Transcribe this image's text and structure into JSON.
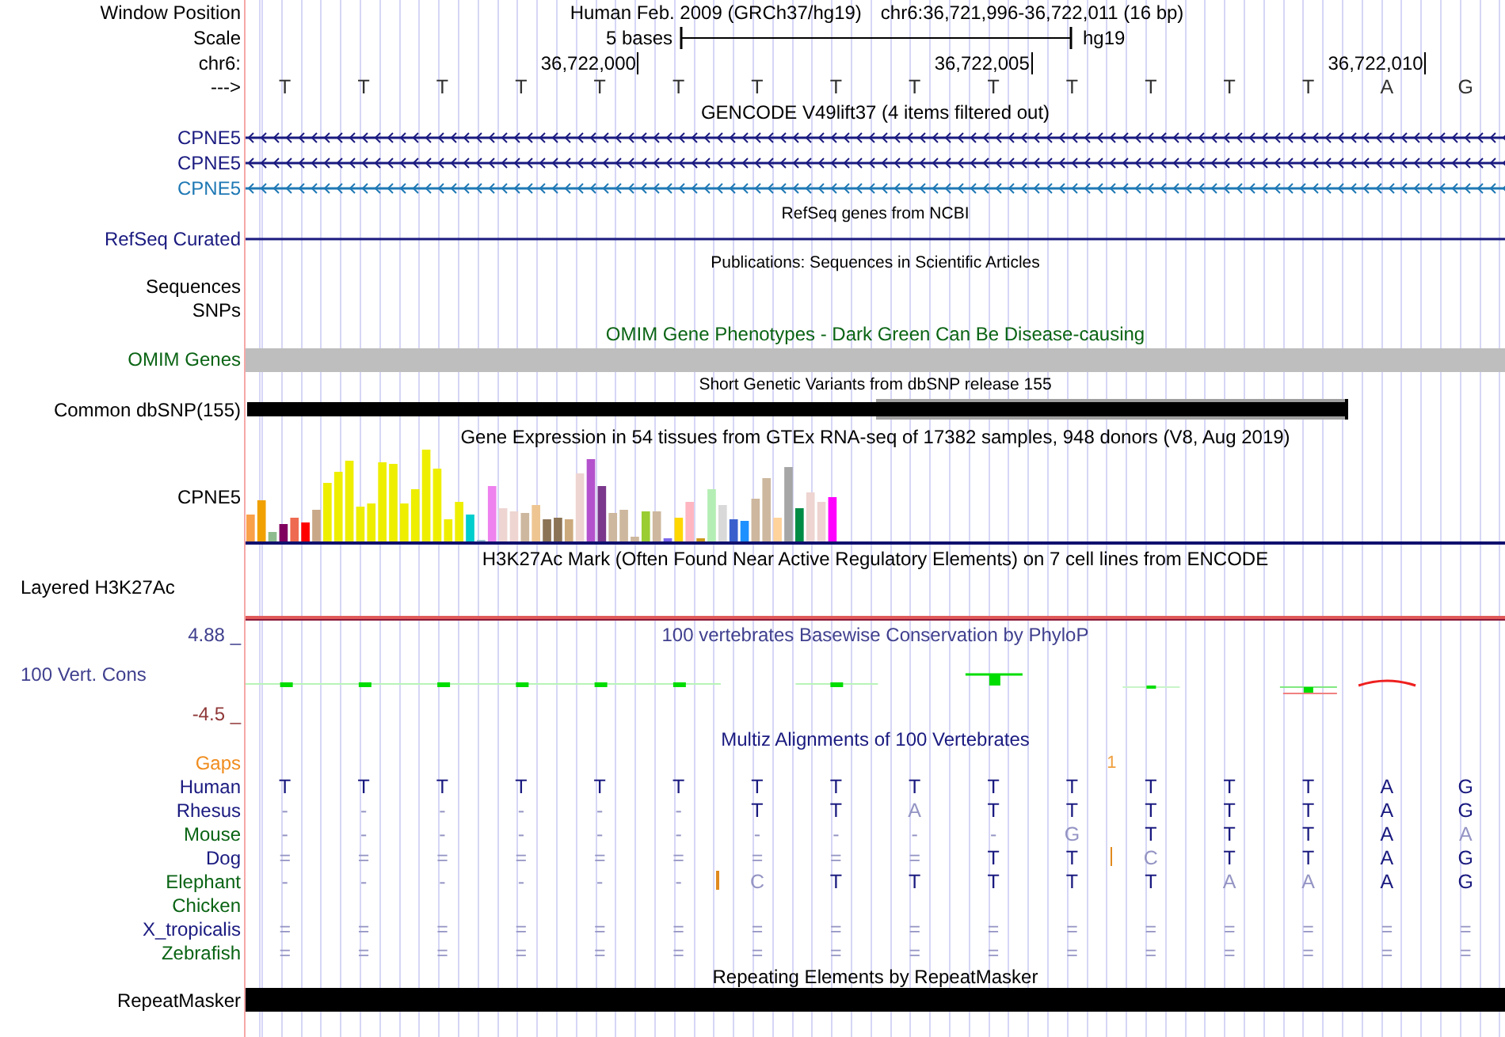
{
  "position": {
    "label": "Window Position",
    "assembly": "Human Feb. 2009 (GRCh37/hg19)",
    "range": "chr6:36,721,996-36,722,011 (16 bp)"
  },
  "scale": {
    "label": "Scale",
    "span": "5 bases",
    "db": "hg19"
  },
  "ruler": {
    "label": "chr6:",
    "ticks": [
      "36,722,000",
      "36,722,005",
      "36,722,010"
    ]
  },
  "sequence": {
    "label": "--->",
    "bases": [
      "T",
      "T",
      "T",
      "T",
      "T",
      "T",
      "T",
      "T",
      "T",
      "T",
      "T",
      "T",
      "T",
      "T",
      "A",
      "G"
    ]
  },
  "tracks": [
    {
      "kind": "gencode",
      "title": "GENCODE V49lift37 (4 items filtered out)",
      "items": [
        {
          "label": "CPNE5",
          "color": "#1a1a80",
          "arrows": true
        },
        {
          "label": "CPNE5",
          "color": "#1a1a80",
          "arrows": true
        },
        {
          "label": "CPNE5",
          "color": "#1e78b4",
          "arrows": true
        }
      ]
    },
    {
      "kind": "refseq",
      "title": "RefSeq genes from NCBI",
      "items": [
        {
          "label": "RefSeq Curated",
          "color": "#1a1a80",
          "arrows": false
        }
      ]
    },
    {
      "kind": "pubs",
      "title": "Publications: Sequences in Scientific Articles",
      "labels": [
        "Sequences",
        "SNPs"
      ]
    },
    {
      "kind": "omim",
      "title": "OMIM Gene Phenotypes - Dark Green Can Be Disease-causing",
      "label": "OMIM Genes"
    },
    {
      "kind": "dbsnp",
      "title": "Short Genetic Variants from dbSNP release 155",
      "label": "Common dbSNP(155)"
    },
    {
      "kind": "gtex",
      "title": "Gene Expression in 54 tissues from GTEx RNA-seq of 17382 samples, 948 donors (V8, Aug 2019)",
      "label": "CPNE5"
    },
    {
      "kind": "h3k27ac",
      "title": "H3K27Ac Mark (Often Found Near Active Regulatory Elements) on 7 cell lines from ENCODE",
      "label": "Layered H3K27Ac"
    },
    {
      "kind": "phylop",
      "title": "100 vertebrates Basewise Conservation by PhyloP",
      "label": "100 Vert. Cons",
      "max": "4.88 _",
      "min": "-4.5 _"
    },
    {
      "kind": "multiz",
      "title": "Multiz Alignments of 100 Vertebrates",
      "gaps": {
        "label": "Gaps",
        "count": "1"
      },
      "species": [
        {
          "name": "Human",
          "color": "#1a1a80",
          "bases": [
            "T",
            "T",
            "T",
            "T",
            "T",
            "T",
            "T",
            "T",
            "T",
            "T",
            "T",
            "T",
            "T",
            "T",
            "A",
            "G"
          ],
          "insert_before": [
            false,
            false,
            false,
            false,
            false,
            false,
            false,
            false,
            false,
            false,
            false,
            false,
            false,
            false,
            false,
            false
          ]
        },
        {
          "name": "Rhesus",
          "color": "#1a1a80",
          "bases": [
            "-",
            "-",
            "-",
            "-",
            "-",
            "-",
            "T",
            "T",
            "A",
            "T",
            "T",
            "T",
            "T",
            "T",
            "A",
            "G"
          ],
          "insert_before": [
            false,
            false,
            false,
            false,
            false,
            false,
            false,
            false,
            false,
            false,
            false,
            false,
            false,
            false,
            false,
            false
          ]
        },
        {
          "name": "Mouse",
          "color": "#0a6414",
          "bases": [
            "-",
            "-",
            "-",
            "-",
            "-",
            "-",
            "-",
            "-",
            "-",
            "-",
            "G",
            "T",
            "T",
            "T",
            "A",
            "A"
          ],
          "insert_before": [
            false,
            false,
            false,
            false,
            false,
            false,
            false,
            false,
            false,
            false,
            false,
            false,
            false,
            false,
            false,
            false
          ]
        },
        {
          "name": "Dog",
          "color": "#1a1a80",
          "bases": [
            "=",
            "=",
            "=",
            "=",
            "=",
            "=",
            "=",
            "=",
            "=",
            "T",
            "T",
            "C",
            "T",
            "T",
            "A",
            "G"
          ],
          "insert_before": [
            false,
            false,
            false,
            false,
            false,
            false,
            false,
            false,
            false,
            false,
            false,
            true,
            false,
            false,
            false,
            false
          ]
        },
        {
          "name": "Elephant",
          "color": "#0a6414",
          "bases": [
            "-",
            "-",
            "-",
            "-",
            "-",
            "-",
            "C",
            "T",
            "T",
            "T",
            "T",
            "T",
            "A",
            "A",
            "A",
            "G"
          ],
          "insert_before": [
            false,
            false,
            false,
            false,
            false,
            false,
            true,
            false,
            false,
            false,
            false,
            false,
            false,
            false,
            false,
            false
          ]
        },
        {
          "name": "Chicken",
          "color": "#0a6414"
        },
        {
          "name": "X_tropicalis",
          "color": "#1a1a80",
          "bases": [
            "=",
            "=",
            "=",
            "=",
            "=",
            "=",
            "=",
            "=",
            "=",
            "=",
            "=",
            "=",
            "=",
            "=",
            "=",
            "="
          ],
          "insert_before": [
            false,
            false,
            false,
            false,
            false,
            false,
            false,
            false,
            false,
            false,
            false,
            false,
            false,
            false,
            false,
            false
          ]
        },
        {
          "name": "Zebrafish",
          "color": "#0a6414",
          "bases": [
            "=",
            "=",
            "=",
            "=",
            "=",
            "=",
            "=",
            "=",
            "=",
            "=",
            "=",
            "=",
            "=",
            "=",
            "=",
            "="
          ],
          "insert_before": [
            false,
            false,
            false,
            false,
            false,
            false,
            false,
            false,
            false,
            false,
            false,
            false,
            false,
            false,
            false,
            false
          ]
        }
      ]
    },
    {
      "kind": "rmsk",
      "title": "Repeating Elements by RepeatMasker",
      "label": "RepeatMasker"
    }
  ]
}
